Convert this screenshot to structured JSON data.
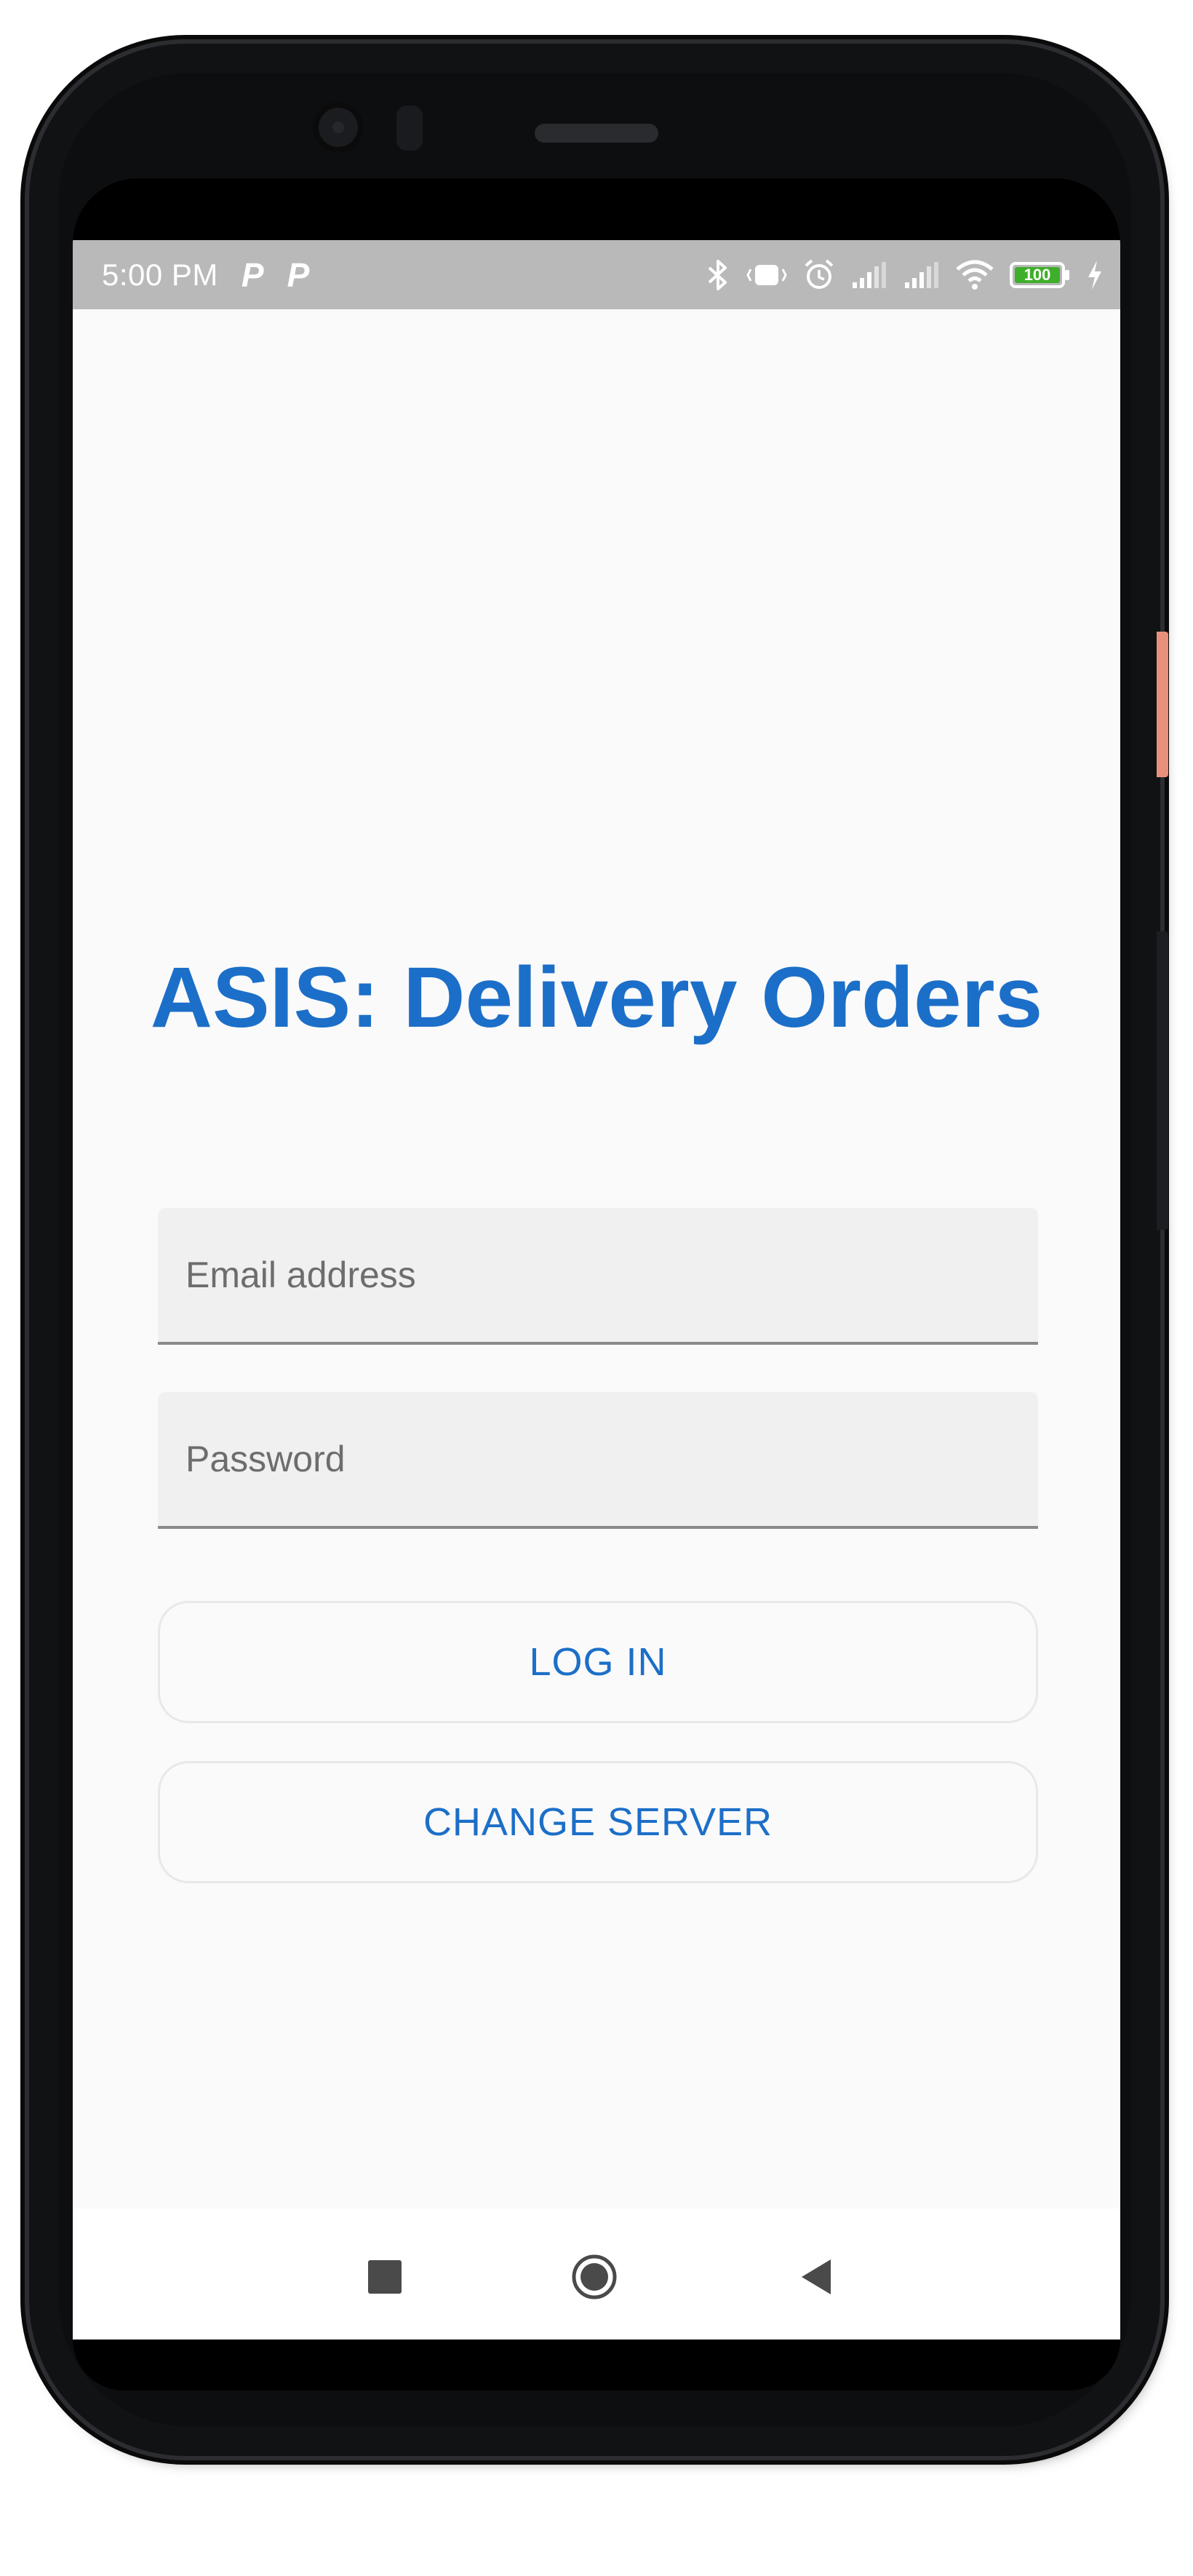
{
  "status_bar": {
    "time": "5:00 PM",
    "notification_1": "P",
    "notification_2": "P",
    "icons": [
      "bluetooth-icon",
      "vibrate-icon",
      "alarm-icon",
      "signal-icon",
      "signal-icon",
      "wifi-icon",
      "battery-icon",
      "charging-icon"
    ],
    "battery_level": "100"
  },
  "app": {
    "title": "ASIS: Delivery Orders",
    "email": {
      "placeholder": "Email address",
      "value": ""
    },
    "password": {
      "placeholder": "Password",
      "value": ""
    },
    "login_label": "LOG IN",
    "change_server_label": "CHANGE SERVER"
  },
  "nav_bar": {
    "buttons": [
      "recent-apps",
      "home",
      "back"
    ]
  },
  "colors": {
    "accent": "#1c6fc8",
    "status_bar": "#b9b9b9",
    "background": "#fafafa",
    "field_background": "#f0f0f0"
  }
}
